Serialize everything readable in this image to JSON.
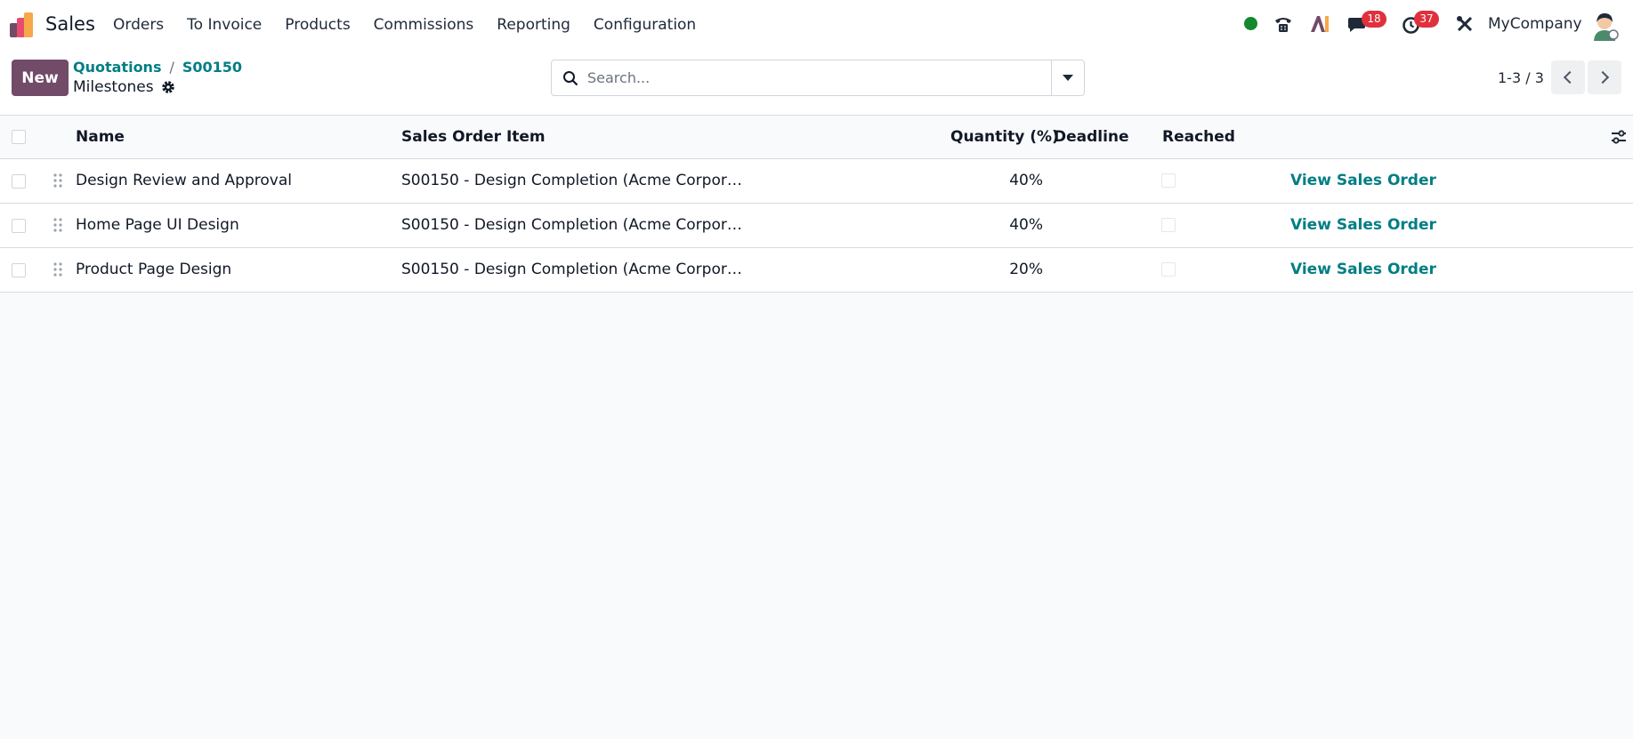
{
  "app": {
    "name": "Sales",
    "menu": [
      "Orders",
      "To Invoice",
      "Products",
      "Commissions",
      "Reporting",
      "Configuration"
    ]
  },
  "systray": {
    "messages_count": "18",
    "activities_count": "37",
    "company": "MyCompany"
  },
  "control": {
    "new_label": "New",
    "breadcrumb": [
      "Quotations",
      "S00150"
    ],
    "title": "Milestones",
    "search_placeholder": "Search...",
    "pager": "1-3 / 3"
  },
  "table": {
    "columns": [
      "Name",
      "Sales Order Item",
      "Quantity (%)",
      "Deadline",
      "Reached"
    ],
    "rows": [
      {
        "name": "Design Review and Approval",
        "item": "S00150 - Design Completion (Acme Corpor…",
        "qty": "40%",
        "deadline": "",
        "action": "View Sales Order"
      },
      {
        "name": "Home Page UI Design",
        "item": "S00150 - Design Completion (Acme Corpor…",
        "qty": "40%",
        "deadline": "",
        "action": "View Sales Order"
      },
      {
        "name": "Product Page Design",
        "item": "S00150 - Design Completion (Acme Corpor…",
        "qty": "20%",
        "deadline": "",
        "action": "View Sales Order"
      }
    ]
  },
  "colors": {
    "brand": "#714b67",
    "link": "#017e84",
    "badge": "#e0303d",
    "online": "#13882e"
  }
}
